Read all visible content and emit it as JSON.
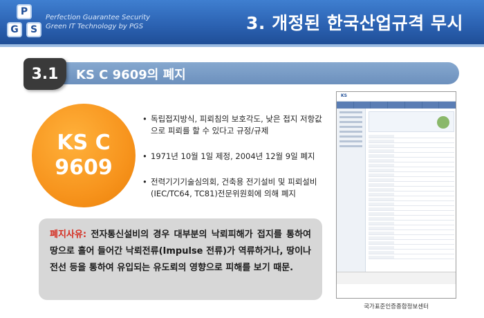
{
  "header": {
    "title": "3. 개정된 한국산업규격 무시",
    "logo_letters": [
      "P",
      "G",
      "S"
    ],
    "tagline_1": "Perfection Guarantee Security",
    "tagline_2": "Green IT Technology by PGS",
    "brand_color": "#2c63b3"
  },
  "section": {
    "number": "3.1",
    "title": "KS C 9609의 폐지"
  },
  "circle": {
    "line1": "KS C",
    "line2": "9609",
    "color": "#f7941d"
  },
  "bullets": [
    "독립접지방식, 피뢰침의 보호각도, 낮은 접지 저항값으로 피뢰를 할 수 있다고 규정/규제",
    "1971년 10월 1일 제정, 2004년 12월 9일 폐지",
    "전력기기기술심의회, 건축용 전기설비 및 피뢰설비(IEC/TC64, TC81)전문위원회에 의해 폐지"
  ],
  "reason": {
    "label": "폐지사유:",
    "text": " 전자통신설비의 경우 대부분의 낙뢰피해가 접지를 통하여 땅으로 흘어 들어간 낙뢰전류(Impulse 전류)가 역류하거나, 땅이나 전선 등을 통하여 유입되는 유도뢰의 영향으로 피해를 보기 때문.",
    "label_color": "#d52b1e"
  },
  "screenshot": {
    "caption": "국가표준인증종합정보센터"
  }
}
